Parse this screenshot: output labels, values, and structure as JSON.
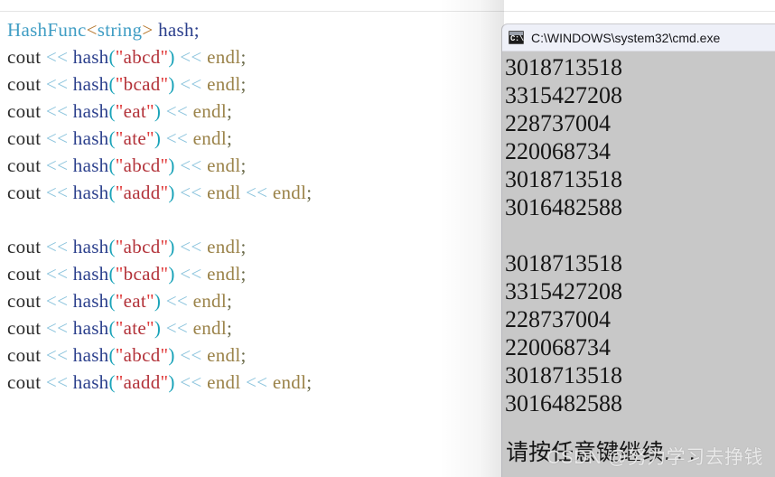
{
  "editor": {
    "language": "cpp",
    "colors": {
      "type": "#3f9dc4",
      "identifier": "#2b3f8c",
      "operator": "#8cc4dd",
      "string": "#b3333a",
      "endl": "#9a8248",
      "paren": "#17a2b8",
      "angle": "#b5752a",
      "plain": "#2a2a2a",
      "background": "#ffffff"
    },
    "lines": [
      {
        "id": "l1",
        "tokens": [
          {
            "t": "HashFunc",
            "c": "tk-type"
          },
          {
            "t": "<",
            "c": "tk-angle"
          },
          {
            "t": "string",
            "c": "tk-type"
          },
          {
            "t": ">",
            "c": "tk-angle"
          },
          {
            "t": " ",
            "c": "tk-plain"
          },
          {
            "t": "hash",
            "c": "tk-ident"
          },
          {
            "t": ";",
            "c": "tk-semi"
          }
        ]
      },
      {
        "id": "l2",
        "tokens": [
          {
            "t": "cout",
            "c": "tk-plain"
          },
          {
            "t": " ",
            "c": "tk-plain"
          },
          {
            "t": "<<",
            "c": "tk-op"
          },
          {
            "t": " ",
            "c": "tk-plain"
          },
          {
            "t": "hash",
            "c": "tk-ident"
          },
          {
            "t": "(",
            "c": "tk-paren"
          },
          {
            "t": "\"",
            "c": "tk-quote"
          },
          {
            "t": "abcd",
            "c": "tk-str"
          },
          {
            "t": "\"",
            "c": "tk-quote"
          },
          {
            "t": ")",
            "c": "tk-paren"
          },
          {
            "t": " ",
            "c": "tk-plain"
          },
          {
            "t": "<<",
            "c": "tk-op"
          },
          {
            "t": " ",
            "c": "tk-plain"
          },
          {
            "t": "endl",
            "c": "tk-endl"
          },
          {
            "t": ";",
            "c": "tk-semi-d"
          }
        ]
      },
      {
        "id": "l3",
        "tokens": [
          {
            "t": "cout",
            "c": "tk-plain"
          },
          {
            "t": " ",
            "c": "tk-plain"
          },
          {
            "t": "<<",
            "c": "tk-op"
          },
          {
            "t": " ",
            "c": "tk-plain"
          },
          {
            "t": "hash",
            "c": "tk-ident"
          },
          {
            "t": "(",
            "c": "tk-paren"
          },
          {
            "t": "\"",
            "c": "tk-quote"
          },
          {
            "t": "bcad",
            "c": "tk-str"
          },
          {
            "t": "\"",
            "c": "tk-quote"
          },
          {
            "t": ")",
            "c": "tk-paren"
          },
          {
            "t": " ",
            "c": "tk-plain"
          },
          {
            "t": "<<",
            "c": "tk-op"
          },
          {
            "t": " ",
            "c": "tk-plain"
          },
          {
            "t": "endl",
            "c": "tk-endl"
          },
          {
            "t": ";",
            "c": "tk-semi-d"
          }
        ]
      },
      {
        "id": "l4",
        "tokens": [
          {
            "t": "cout",
            "c": "tk-plain"
          },
          {
            "t": " ",
            "c": "tk-plain"
          },
          {
            "t": "<<",
            "c": "tk-op"
          },
          {
            "t": " ",
            "c": "tk-plain"
          },
          {
            "t": "hash",
            "c": "tk-ident"
          },
          {
            "t": "(",
            "c": "tk-paren"
          },
          {
            "t": "\"",
            "c": "tk-quote"
          },
          {
            "t": "eat",
            "c": "tk-str"
          },
          {
            "t": "\"",
            "c": "tk-quote"
          },
          {
            "t": ")",
            "c": "tk-paren"
          },
          {
            "t": " ",
            "c": "tk-plain"
          },
          {
            "t": "<<",
            "c": "tk-op"
          },
          {
            "t": " ",
            "c": "tk-plain"
          },
          {
            "t": "endl",
            "c": "tk-endl"
          },
          {
            "t": ";",
            "c": "tk-semi-d"
          }
        ]
      },
      {
        "id": "l5",
        "tokens": [
          {
            "t": "cout",
            "c": "tk-plain"
          },
          {
            "t": " ",
            "c": "tk-plain"
          },
          {
            "t": "<<",
            "c": "tk-op"
          },
          {
            "t": " ",
            "c": "tk-plain"
          },
          {
            "t": "hash",
            "c": "tk-ident"
          },
          {
            "t": "(",
            "c": "tk-paren"
          },
          {
            "t": "\"",
            "c": "tk-quote"
          },
          {
            "t": "ate",
            "c": "tk-str"
          },
          {
            "t": "\"",
            "c": "tk-quote"
          },
          {
            "t": ")",
            "c": "tk-paren"
          },
          {
            "t": " ",
            "c": "tk-plain"
          },
          {
            "t": "<<",
            "c": "tk-op"
          },
          {
            "t": " ",
            "c": "tk-plain"
          },
          {
            "t": "endl",
            "c": "tk-endl"
          },
          {
            "t": ";",
            "c": "tk-semi-d"
          }
        ]
      },
      {
        "id": "l6",
        "tokens": [
          {
            "t": "cout",
            "c": "tk-plain"
          },
          {
            "t": " ",
            "c": "tk-plain"
          },
          {
            "t": "<<",
            "c": "tk-op"
          },
          {
            "t": " ",
            "c": "tk-plain"
          },
          {
            "t": "hash",
            "c": "tk-ident"
          },
          {
            "t": "(",
            "c": "tk-paren"
          },
          {
            "t": "\"",
            "c": "tk-quote"
          },
          {
            "t": "abcd",
            "c": "tk-str"
          },
          {
            "t": "\"",
            "c": "tk-quote"
          },
          {
            "t": ")",
            "c": "tk-paren"
          },
          {
            "t": " ",
            "c": "tk-plain"
          },
          {
            "t": "<<",
            "c": "tk-op"
          },
          {
            "t": " ",
            "c": "tk-plain"
          },
          {
            "t": "endl",
            "c": "tk-endl"
          },
          {
            "t": ";",
            "c": "tk-semi-d"
          }
        ]
      },
      {
        "id": "l7",
        "tokens": [
          {
            "t": "cout",
            "c": "tk-plain"
          },
          {
            "t": " ",
            "c": "tk-plain"
          },
          {
            "t": "<<",
            "c": "tk-op"
          },
          {
            "t": " ",
            "c": "tk-plain"
          },
          {
            "t": "hash",
            "c": "tk-ident"
          },
          {
            "t": "(",
            "c": "tk-paren"
          },
          {
            "t": "\"",
            "c": "tk-quote"
          },
          {
            "t": "aadd",
            "c": "tk-str"
          },
          {
            "t": "\"",
            "c": "tk-quote"
          },
          {
            "t": ")",
            "c": "tk-paren"
          },
          {
            "t": " ",
            "c": "tk-plain"
          },
          {
            "t": "<<",
            "c": "tk-op"
          },
          {
            "t": " ",
            "c": "tk-plain"
          },
          {
            "t": "endl",
            "c": "tk-endl"
          },
          {
            "t": " ",
            "c": "tk-plain"
          },
          {
            "t": "<<",
            "c": "tk-op"
          },
          {
            "t": " ",
            "c": "tk-plain"
          },
          {
            "t": "endl",
            "c": "tk-endl"
          },
          {
            "t": ";",
            "c": "tk-semi-d"
          }
        ]
      },
      {
        "id": "l8",
        "blank": true,
        "tokens": []
      },
      {
        "id": "l9",
        "tokens": [
          {
            "t": "cout",
            "c": "tk-plain"
          },
          {
            "t": " ",
            "c": "tk-plain"
          },
          {
            "t": "<<",
            "c": "tk-op"
          },
          {
            "t": " ",
            "c": "tk-plain"
          },
          {
            "t": "hash",
            "c": "tk-ident"
          },
          {
            "t": "(",
            "c": "tk-paren"
          },
          {
            "t": "\"",
            "c": "tk-quote"
          },
          {
            "t": "abcd",
            "c": "tk-str"
          },
          {
            "t": "\"",
            "c": "tk-quote"
          },
          {
            "t": ")",
            "c": "tk-paren"
          },
          {
            "t": " ",
            "c": "tk-plain"
          },
          {
            "t": "<<",
            "c": "tk-op"
          },
          {
            "t": " ",
            "c": "tk-plain"
          },
          {
            "t": "endl",
            "c": "tk-endl"
          },
          {
            "t": ";",
            "c": "tk-semi-d"
          }
        ]
      },
      {
        "id": "l10",
        "tokens": [
          {
            "t": "cout",
            "c": "tk-plain"
          },
          {
            "t": " ",
            "c": "tk-plain"
          },
          {
            "t": "<<",
            "c": "tk-op"
          },
          {
            "t": " ",
            "c": "tk-plain"
          },
          {
            "t": "hash",
            "c": "tk-ident"
          },
          {
            "t": "(",
            "c": "tk-paren"
          },
          {
            "t": "\"",
            "c": "tk-quote"
          },
          {
            "t": "bcad",
            "c": "tk-str"
          },
          {
            "t": "\"",
            "c": "tk-quote"
          },
          {
            "t": ")",
            "c": "tk-paren"
          },
          {
            "t": " ",
            "c": "tk-plain"
          },
          {
            "t": "<<",
            "c": "tk-op"
          },
          {
            "t": " ",
            "c": "tk-plain"
          },
          {
            "t": "endl",
            "c": "tk-endl"
          },
          {
            "t": ";",
            "c": "tk-semi-d"
          }
        ]
      },
      {
        "id": "l11",
        "tokens": [
          {
            "t": "cout",
            "c": "tk-plain"
          },
          {
            "t": " ",
            "c": "tk-plain"
          },
          {
            "t": "<<",
            "c": "tk-op"
          },
          {
            "t": " ",
            "c": "tk-plain"
          },
          {
            "t": "hash",
            "c": "tk-ident"
          },
          {
            "t": "(",
            "c": "tk-paren"
          },
          {
            "t": "\"",
            "c": "tk-quote"
          },
          {
            "t": "eat",
            "c": "tk-str"
          },
          {
            "t": "\"",
            "c": "tk-quote"
          },
          {
            "t": ")",
            "c": "tk-paren"
          },
          {
            "t": " ",
            "c": "tk-plain"
          },
          {
            "t": "<<",
            "c": "tk-op"
          },
          {
            "t": " ",
            "c": "tk-plain"
          },
          {
            "t": "endl",
            "c": "tk-endl"
          },
          {
            "t": ";",
            "c": "tk-semi-d"
          }
        ]
      },
      {
        "id": "l12",
        "tokens": [
          {
            "t": "cout",
            "c": "tk-plain"
          },
          {
            "t": " ",
            "c": "tk-plain"
          },
          {
            "t": "<<",
            "c": "tk-op"
          },
          {
            "t": " ",
            "c": "tk-plain"
          },
          {
            "t": "hash",
            "c": "tk-ident"
          },
          {
            "t": "(",
            "c": "tk-paren"
          },
          {
            "t": "\"",
            "c": "tk-quote"
          },
          {
            "t": "ate",
            "c": "tk-str"
          },
          {
            "t": "\"",
            "c": "tk-quote"
          },
          {
            "t": ")",
            "c": "tk-paren"
          },
          {
            "t": " ",
            "c": "tk-plain"
          },
          {
            "t": "<<",
            "c": "tk-op"
          },
          {
            "t": " ",
            "c": "tk-plain"
          },
          {
            "t": "endl",
            "c": "tk-endl"
          },
          {
            "t": ";",
            "c": "tk-semi-d"
          }
        ]
      },
      {
        "id": "l13",
        "tokens": [
          {
            "t": "cout",
            "c": "tk-plain"
          },
          {
            "t": " ",
            "c": "tk-plain"
          },
          {
            "t": "<<",
            "c": "tk-op"
          },
          {
            "t": " ",
            "c": "tk-plain"
          },
          {
            "t": "hash",
            "c": "tk-ident"
          },
          {
            "t": "(",
            "c": "tk-paren"
          },
          {
            "t": "\"",
            "c": "tk-quote"
          },
          {
            "t": "abcd",
            "c": "tk-str"
          },
          {
            "t": "\"",
            "c": "tk-quote"
          },
          {
            "t": ")",
            "c": "tk-paren"
          },
          {
            "t": " ",
            "c": "tk-plain"
          },
          {
            "t": "<<",
            "c": "tk-op"
          },
          {
            "t": " ",
            "c": "tk-plain"
          },
          {
            "t": "endl",
            "c": "tk-endl"
          },
          {
            "t": ";",
            "c": "tk-semi-d"
          }
        ]
      },
      {
        "id": "l14",
        "tokens": [
          {
            "t": "cout",
            "c": "tk-plain"
          },
          {
            "t": " ",
            "c": "tk-plain"
          },
          {
            "t": "<<",
            "c": "tk-op"
          },
          {
            "t": " ",
            "c": "tk-plain"
          },
          {
            "t": "hash",
            "c": "tk-ident"
          },
          {
            "t": "(",
            "c": "tk-paren"
          },
          {
            "t": "\"",
            "c": "tk-quote"
          },
          {
            "t": "aadd",
            "c": "tk-str"
          },
          {
            "t": "\"",
            "c": "tk-quote"
          },
          {
            "t": ")",
            "c": "tk-paren"
          },
          {
            "t": " ",
            "c": "tk-plain"
          },
          {
            "t": "<<",
            "c": "tk-op"
          },
          {
            "t": " ",
            "c": "tk-plain"
          },
          {
            "t": "endl",
            "c": "tk-endl"
          },
          {
            "t": " ",
            "c": "tk-plain"
          },
          {
            "t": "<<",
            "c": "tk-op"
          },
          {
            "t": " ",
            "c": "tk-plain"
          },
          {
            "t": "endl",
            "c": "tk-endl"
          },
          {
            "t": ";",
            "c": "tk-semi-d"
          }
        ]
      }
    ]
  },
  "console": {
    "title": "C:\\WINDOWS\\system32\\cmd.exe",
    "icon": "cmd-icon",
    "icon_glyph": "C:\\.",
    "titlebar_color": "#eef0f8",
    "body_color": "#c8c8c8",
    "output": [
      {
        "text": "3018713518"
      },
      {
        "text": "3315427208"
      },
      {
        "text": "228737004"
      },
      {
        "text": "220068734"
      },
      {
        "text": "3018713518"
      },
      {
        "text": "3016482588"
      },
      {
        "text": "",
        "blank": true
      },
      {
        "text": "3018713518"
      },
      {
        "text": "3315427208"
      },
      {
        "text": "228737004"
      },
      {
        "text": "220068734"
      },
      {
        "text": "3018713518"
      },
      {
        "text": "3016482588"
      }
    ],
    "prompt": "请按任意键继续. . ."
  },
  "watermark": {
    "text": "CSDN @努力学习去挣钱"
  }
}
